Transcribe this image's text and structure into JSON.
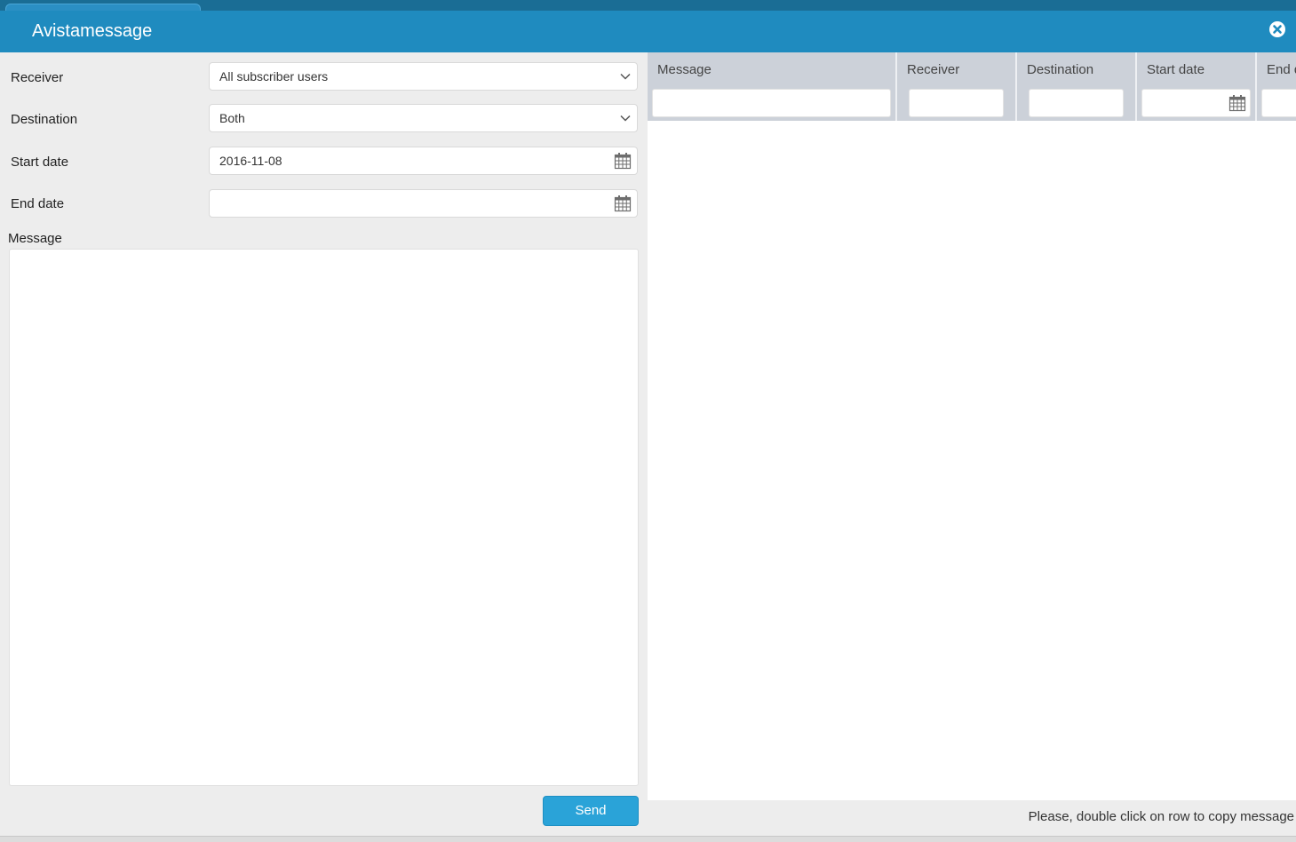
{
  "window": {
    "title": "Avistamessage"
  },
  "form": {
    "receiver": {
      "label": "Receiver",
      "value": "All subscriber users"
    },
    "destination": {
      "label": "Destination",
      "value": "Both"
    },
    "start_date": {
      "label": "Start date",
      "value": "2016-11-08"
    },
    "end_date": {
      "label": "End date",
      "value": ""
    },
    "message": {
      "label": "Message",
      "value": ""
    },
    "send_label": "Send"
  },
  "grid": {
    "columns": [
      {
        "label": "Message"
      },
      {
        "label": "Receiver"
      },
      {
        "label": "Destination"
      },
      {
        "label": "Start date"
      },
      {
        "label": "End d"
      }
    ]
  },
  "footer": {
    "note": "Please, double click on row to copy message"
  },
  "colors": {
    "titlebar": "#1f8bbf",
    "accent": "#2aa3d8"
  }
}
